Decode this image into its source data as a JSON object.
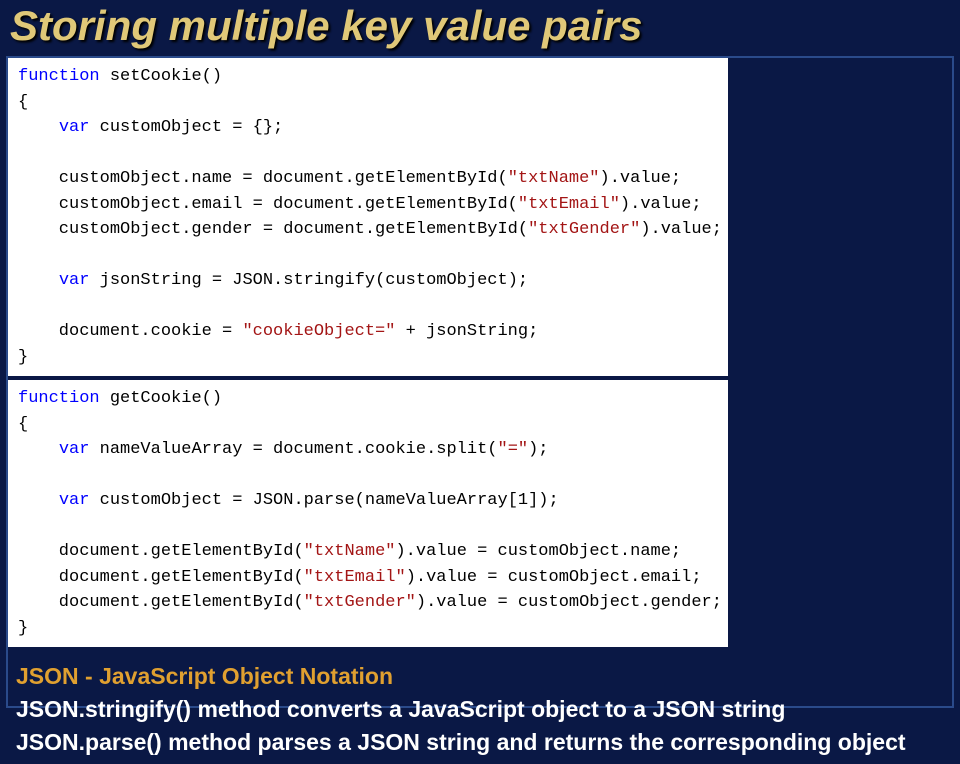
{
  "title": "Storing multiple key value pairs",
  "code1": {
    "l1a": "function",
    "l1b": " setCookie()",
    "l2": "{",
    "l3a": "    ",
    "l3b": "var",
    "l3c": " customObject = {};",
    "l4": "",
    "l5a": "    customObject.name = document.getElementById(",
    "l5b": "\"txtName\"",
    "l5c": ").value;",
    "l6a": "    customObject.email = document.getElementById(",
    "l6b": "\"txtEmail\"",
    "l6c": ").value;",
    "l7a": "    customObject.gender = document.getElementById(",
    "l7b": "\"txtGender\"",
    "l7c": ").value;",
    "l8": "",
    "l9a": "    ",
    "l9b": "var",
    "l9c": " jsonString = JSON.stringify(customObject);",
    "l10": "",
    "l11a": "    document.cookie = ",
    "l11b": "\"cookieObject=\"",
    "l11c": " + jsonString;",
    "l12": "}"
  },
  "code2": {
    "l1a": "function",
    "l1b": " getCookie()",
    "l2": "{",
    "l3a": "    ",
    "l3b": "var",
    "l3c": " nameValueArray = document.cookie.split(",
    "l3d": "\"=\"",
    "l3e": ");",
    "l4": "",
    "l5a": "    ",
    "l5b": "var",
    "l5c": " customObject = JSON.parse(nameValueArray[1]);",
    "l6": "",
    "l7a": "    document.getElementById(",
    "l7b": "\"txtName\"",
    "l7c": ").value = customObject.name;",
    "l8a": "    document.getElementById(",
    "l8b": "\"txtEmail\"",
    "l8c": ").value = customObject.email;",
    "l9a": "    document.getElementById(",
    "l9b": "\"txtGender\"",
    "l9c": ").value = customObject.gender;",
    "l10": "}"
  },
  "notes": {
    "json_title": "JSON - JavaScript Object Notation",
    "line1": "JSON.stringify() method converts a JavaScript object to a JSON string",
    "line2": "JSON.parse() method parses a JSON string and returns the corresponding object"
  }
}
